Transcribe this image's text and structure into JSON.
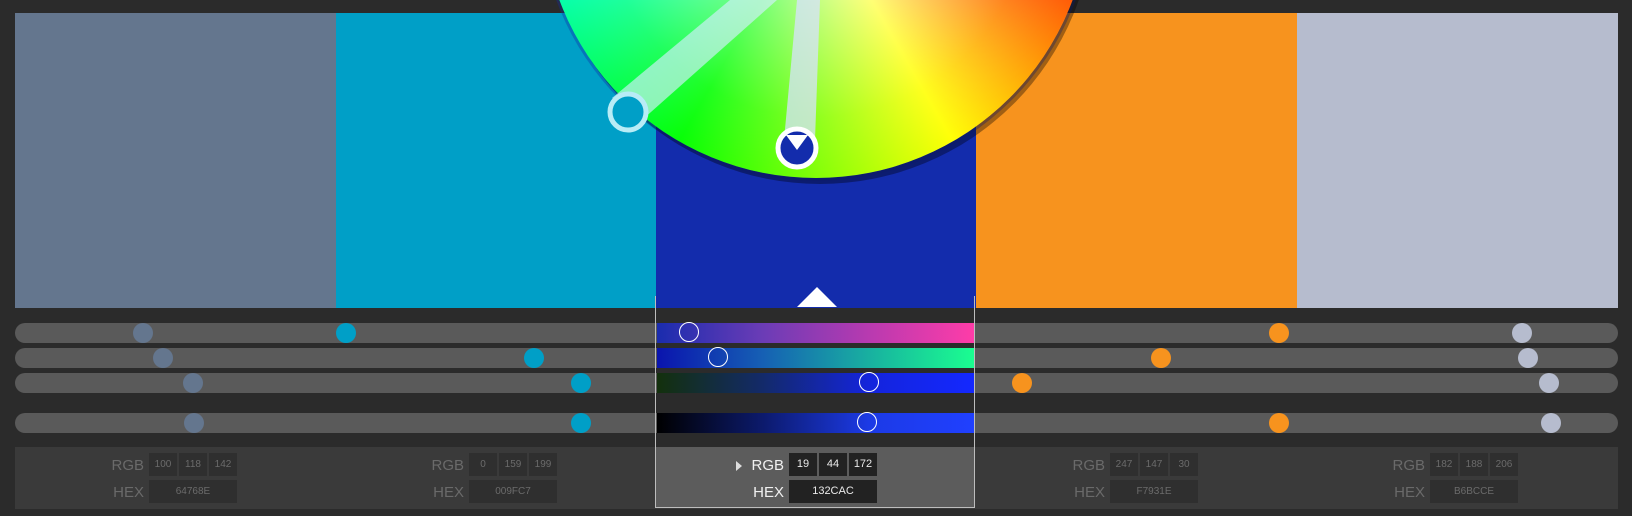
{
  "swatches": [
    {
      "hex_color": "#64768E",
      "rgb": [
        "100",
        "118",
        "142"
      ],
      "hex": "64768E",
      "selected": false
    },
    {
      "hex_color": "#009FC7",
      "rgb": [
        "0",
        "159",
        "199"
      ],
      "hex": "009FC7",
      "selected": false
    },
    {
      "hex_color": "#132CAC",
      "rgb": [
        "19",
        "44",
        "172"
      ],
      "hex": "132CAC",
      "selected": true
    },
    {
      "hex_color": "#F7931E",
      "rgb": [
        "247",
        "147",
        "30"
      ],
      "hex": "F7931E",
      "selected": false
    },
    {
      "hex_color": "#B6BCCE",
      "rgb": [
        "182",
        "188",
        "206"
      ],
      "hex": "B6BCCE",
      "selected": false
    }
  ],
  "labels": {
    "rgb": "RGB",
    "hex": "HEX"
  },
  "color_wheel": {
    "icon": "color-wheel",
    "handles": [
      "#009FC7",
      "#132CAC"
    ]
  },
  "sliders": {
    "channel_1_dots": {
      "swatch_1": 0.08,
      "swatch_2": 0.2,
      "swatch_3": 0.42,
      "swatch_4": 0.79,
      "swatch_5": 0.94
    },
    "channel_2_dots": {
      "swatch_1": 0.093,
      "swatch_2": 0.32,
      "swatch_3": 0.44,
      "swatch_4": 0.72,
      "swatch_5": 0.945
    },
    "channel_3_dots": {
      "swatch_1": 0.11,
      "swatch_2": 0.35,
      "swatch_3": 0.53,
      "swatch_4": 0.63,
      "swatch_5": 0.96
    },
    "brightness_dots": {
      "swatch_1": 0.11,
      "swatch_2": 0.35,
      "swatch_3": 0.53,
      "swatch_4": 0.79,
      "swatch_5": 0.96
    }
  }
}
